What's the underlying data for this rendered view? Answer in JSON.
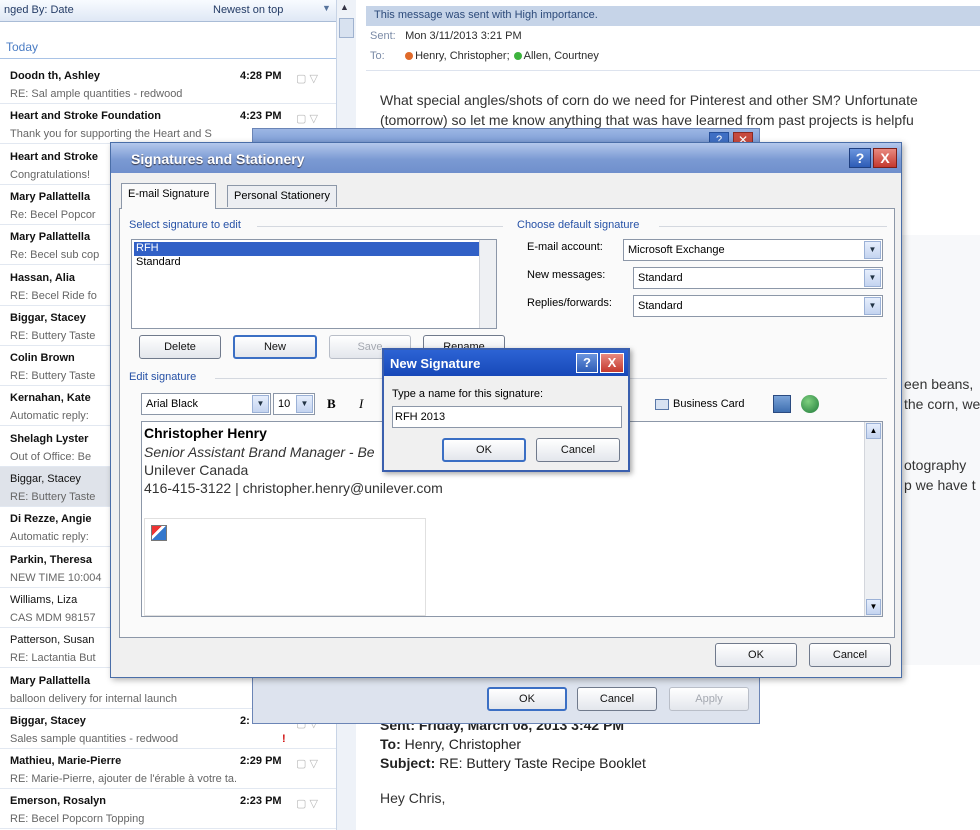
{
  "mail_list": {
    "header_left": "nged By: Date",
    "header_right": "Newest on top",
    "group": "Today",
    "items": [
      {
        "from": "Doodn   th, Ashley",
        "subject": "RE: Sal   ample quantities - redwood",
        "time": "4:28 PM",
        "read": false,
        "selected": false
      },
      {
        "from": "Heart and Stroke Foundation",
        "subject": "Thank you for supporting the Heart and S",
        "time": "4:23 PM",
        "read": false,
        "selected": false
      },
      {
        "from": "Heart and Stroke",
        "subject": "Congratulations!",
        "time": "",
        "read": false,
        "selected": false
      },
      {
        "from": "Mary Pallattella",
        "subject": "Re: Becel Popcor",
        "time": "",
        "read": false,
        "selected": false
      },
      {
        "from": "Mary Pallattella",
        "subject": "Re: Becel sub cop",
        "time": "",
        "read": false,
        "selected": false
      },
      {
        "from": "Hassan, Alia",
        "subject": "RE: Becel Ride fo",
        "time": "",
        "read": false,
        "selected": false
      },
      {
        "from": "Biggar, Stacey",
        "subject": "RE: Buttery Taste",
        "time": "",
        "read": false,
        "selected": false
      },
      {
        "from": "Colin Brown",
        "subject": "RE: Buttery Taste",
        "time": "",
        "read": false,
        "selected": false
      },
      {
        "from": "Kernahan, Kate",
        "subject": "Automatic reply:",
        "time": "",
        "read": false,
        "selected": false
      },
      {
        "from": "Shelagh Lyster",
        "subject": "Out of Office: Be",
        "time": "",
        "read": false,
        "selected": false
      },
      {
        "from": "Biggar, Stacey",
        "subject": "RE: Buttery Taste",
        "time": "",
        "read": true,
        "selected": true
      },
      {
        "from": "Di Rezze, Angie",
        "subject": "Automatic reply:",
        "time": "",
        "read": false,
        "selected": false
      },
      {
        "from": "Parkin, Theresa",
        "subject": "NEW TIME 10:004",
        "time": "",
        "read": false,
        "selected": false
      },
      {
        "from": "Williams, Liza",
        "subject": "CAS MDM 98157",
        "time": "",
        "read": true,
        "selected": false
      },
      {
        "from": "Patterson, Susan",
        "subject": "RE: Lactantia But",
        "time": "",
        "read": true,
        "selected": false
      },
      {
        "from": "Mary Pallattella",
        "subject": "balloon delivery for internal launch",
        "time": "",
        "read": false,
        "selected": false
      },
      {
        "from": "Biggar, Stacey",
        "subject": "Sales sample quantities - redwood",
        "time": "2:",
        "read": false,
        "selected": false,
        "important": true
      },
      {
        "from": "Mathieu, Marie-Pierre",
        "subject": "RE: Marie-Pierre, ajouter de l'érable à votre ta...",
        "time": "2:29 PM",
        "read": false,
        "selected": false
      },
      {
        "from": "Emerson, Rosalyn",
        "subject": "RE: Becel Popcorn Topping",
        "time": "2:23 PM",
        "read": false,
        "selected": false
      }
    ]
  },
  "reading": {
    "importance": "This message was sent with High importance.",
    "sent_label": "Sent:",
    "sent_value": "Mon 3/11/2013 3:21 PM",
    "to_label": "To:",
    "recipients": [
      {
        "name": "Henry, Christopher",
        "color": "#e06a2a"
      },
      {
        "name": "Allen, Courtney",
        "color": "#3db33d"
      }
    ],
    "body_line1": "What special angles/shots of corn do we need for Pinterest and other SM?  Unfortunate",
    "body_line2": "(tomorrow) so let me know anything that was have learned from past projects is helpfu",
    "frag1": "een beans,",
    "frag2": "the corn, we",
    "frag3": "otography",
    "frag4": "p we have t",
    "quote_sent": "Sent: Friday, March 08, 2013 3:42 PM",
    "quote_to_label": "To:",
    "quote_to": "Henry, Christopher",
    "quote_subject_label": "Subject:",
    "quote_subject": "RE: Buttery Taste Recipe Booklet",
    "greeting": "Hey Chris,"
  },
  "bg_dialog": {
    "ok": "OK",
    "cancel": "Cancel",
    "apply": "Apply"
  },
  "sig_dialog": {
    "title": "Signatures and Stationery",
    "help": "?",
    "close": "X",
    "tabs": [
      "E-mail Signature",
      "Personal Stationery"
    ],
    "select_label": "Select signature to edit",
    "signatures": [
      "RFH",
      "Standard"
    ],
    "buttons": {
      "delete": "Delete",
      "new": "New",
      "save": "Save",
      "rename": "Rename"
    },
    "default_label": "Choose default signature",
    "email_account_label": "E-mail account:",
    "email_account_value": "Microsoft Exchange",
    "new_messages_label": "New messages:",
    "new_messages_value": "Standard",
    "replies_label": "Replies/forwards:",
    "replies_value": "Standard",
    "edit_label": "Edit signature",
    "font_value": "Arial Black",
    "size_value": "10",
    "bold": "B",
    "italic": "I",
    "business_card": "Business Card",
    "sig_name": "Christopher Henry",
    "sig_role": "Senior Assistant Brand Manager - Be",
    "sig_company": "Unilever Canada",
    "sig_contact": "416-415-3122 | christopher.henry@unilever.com",
    "ok": "OK",
    "cancel": "Cancel"
  },
  "new_sig": {
    "title": "New Signature",
    "help": "?",
    "close": "X",
    "prompt": "Type a name for this signature:",
    "value": "RFH 2013",
    "ok": "OK",
    "cancel": "Cancel"
  }
}
